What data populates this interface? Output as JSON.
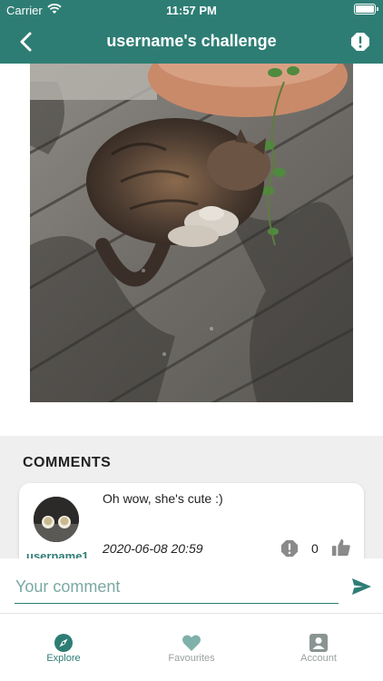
{
  "status_bar": {
    "carrier": "Carrier",
    "time": "11:57 PM"
  },
  "header": {
    "title": "username's challenge"
  },
  "comments": {
    "heading": "COMMENTS",
    "items": [
      {
        "username": "username1",
        "text": "Oh wow, she's cute :)",
        "date": "2020-06-08 20:59",
        "likes": "0"
      }
    ]
  },
  "comment_input": {
    "placeholder": "Your comment"
  },
  "tabs": [
    {
      "label": "Explore",
      "icon": "compass-icon",
      "active": true
    },
    {
      "label": "Favourites",
      "icon": "heart-icon",
      "active": false
    },
    {
      "label": "Account",
      "icon": "account-icon",
      "active": false
    }
  ],
  "colors": {
    "primary": "#2e7d74",
    "inactive": "#9aa0a0",
    "section_bg": "#efefef"
  }
}
